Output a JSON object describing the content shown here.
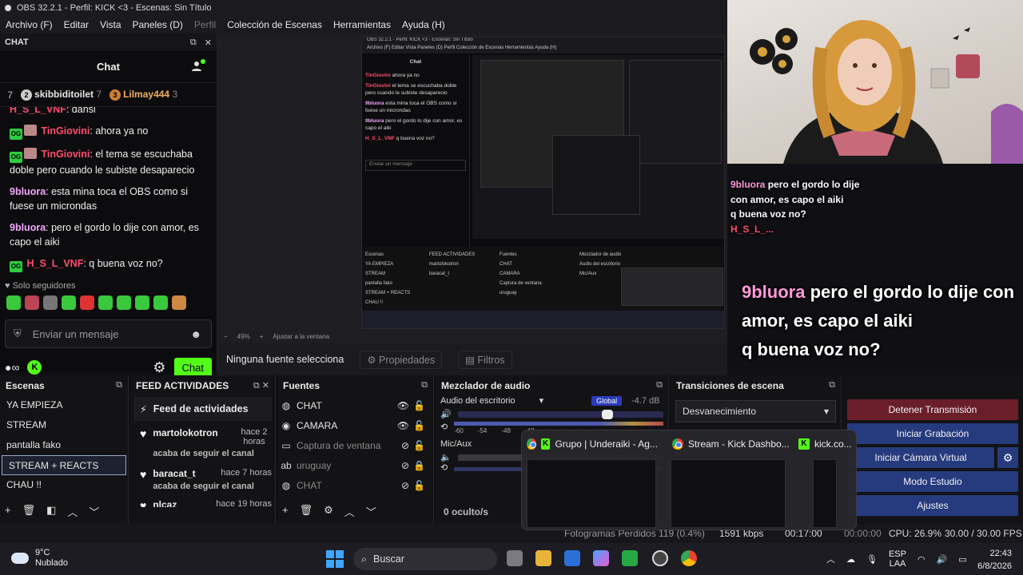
{
  "window": {
    "title": "OBS 32.2.1 - Perfil: KICK <3 - Escenas: Sin Título"
  },
  "menu": [
    "Archivo (F)",
    "Editar",
    "Vista",
    "Paneles (D)",
    "Perfil",
    "Colección de Escenas",
    "Herramientas",
    "Ayuda (H)"
  ],
  "chat_dock": {
    "dock_title": "CHAT",
    "header": "Chat",
    "leaderboard": [
      {
        "prefix": " 7",
        "rank": "2",
        "name": "skibbiditoilet",
        "count": "7"
      },
      {
        "rank": "3",
        "name": "Lilmay444",
        "count": "3"
      }
    ],
    "partial_msg": {
      "user": "H_S_L_VNF",
      "text": ": dansi"
    },
    "messages": [
      {
        "user": "TinGiovini",
        "text": ": ahora ya no"
      },
      {
        "user": "TinGiovini",
        "text": ": el tema se escuchaba doble pero cuando le subiste desaparecio"
      },
      {
        "user": "9bluora",
        "text": ": esta mina toca el OBS como si fuese un microndas"
      },
      {
        "user": "9bluora",
        "text": ": pero el gordo lo dije con amor, es capo el aiki"
      },
      {
        "user": "H_S_L_VNF",
        "text": ": q buena voz no?"
      }
    ],
    "followers_label": "Solo seguidores",
    "input_placeholder": "Enviar un mensaje",
    "send_label": "Chat"
  },
  "preview": {
    "zoom": "49%",
    "fit_label": "Ajustar a la ventana",
    "mini_title": "OBS 32.2.1 - Perfil: KICK <3 - Escenas: Sin Título",
    "mini_menu": "Archivo (F)  Editar  Vista  Paneles (D)  Perfil  Colección de Escenas  Herramientas  Ayuda (H)"
  },
  "context_bar": {
    "no_source": "Ninguna fuente selecciona",
    "properties": "Propiedades",
    "filters": "Filtros"
  },
  "overlay": {
    "small": {
      "user": "9bluora",
      "line1": "pero el gordo lo dije con amor, es capo el aiki",
      "line2": "q buena voz no?",
      "user2": "H_S_L_..."
    },
    "big": {
      "user": "9bluora",
      "text": "pero el gordo lo dije con amor, es capo el aiki",
      "line2": "q buena voz no?"
    }
  },
  "scenes": {
    "title": "Escenas",
    "items": [
      "YA EMPIEZA",
      "STREAM",
      "pantalla fako",
      "STREAM + REACTS",
      "CHAU !!"
    ],
    "selected_index": 3
  },
  "feed": {
    "title": "FEED ACTIVIDADES",
    "header": "Feed de actividades",
    "items": [
      {
        "name": "martolokotron",
        "time": "hace 2 horas",
        "action": "acaba de seguir el canal"
      },
      {
        "name": "baracat_t",
        "time": "hace 7 horas",
        "action": "acaba de seguir el canal"
      },
      {
        "name": "nlcaz",
        "time": "hace 19 horas",
        "action": ""
      }
    ]
  },
  "sources": {
    "title": "Fuentes",
    "items": [
      {
        "name": "CHAT",
        "icon": "globe-icon",
        "visible": true,
        "locked": false
      },
      {
        "name": "CAMARA",
        "icon": "camera-icon",
        "visible": true,
        "locked": false
      },
      {
        "name": "Captura de ventana",
        "icon": "window-icon",
        "visible": false,
        "locked": false
      },
      {
        "name": "uruguay",
        "icon": "text-icon",
        "visible": false,
        "locked": true
      },
      {
        "name": "CHAT",
        "icon": "globe-icon",
        "visible": false,
        "locked": false
      }
    ]
  },
  "mixer": {
    "title": "Mezclador de audio",
    "desktop_label": "Audio del escritorio",
    "global_badge": "Global",
    "desktop_db": "-4.7 dB",
    "mic_label": "Mic/Aux",
    "hidden": "0 oculto/s",
    "scale": [
      "-60",
      "-54",
      "-48",
      "-42"
    ]
  },
  "transitions": {
    "title": "Transiciones de escena",
    "selected": "Desvanecimiento"
  },
  "controls": {
    "stop_stream": "Detener Transmisión",
    "start_record": "Iniciar Grabación",
    "start_vcam": "Iniciar Cámara Virtual",
    "studio": "Modo Estudio",
    "settings": "Ajustes"
  },
  "status": {
    "dropped": "Fotogramas Perdidos 119 (0.4%)",
    "bitrate": "1591 kbps",
    "stream_time": "00:17:00",
    "rec_time": "00:00:00",
    "cpu": "CPU: 26.9%",
    "fps": "30.00 / 30.00 FPS"
  },
  "task_popup": [
    {
      "title": "Grupo | Underaiki - Ag...",
      "icon": "chrome-icon"
    },
    {
      "title": "Stream - Kick Dashbo...",
      "icon": "chrome-icon"
    },
    {
      "title": "kick.co...",
      "icon": "kick-icon"
    }
  ],
  "taskbar": {
    "weather_temp": "9°C",
    "weather_desc": "Nublado",
    "search": "Buscar",
    "lang1": "ESP",
    "lang2": "LAA",
    "time": "22:43",
    "date": "6/8/2026"
  },
  "colors": {
    "kick_green": "#53fc18",
    "stop_red": "#6a1e2a",
    "button_blue": "#263a7e"
  }
}
